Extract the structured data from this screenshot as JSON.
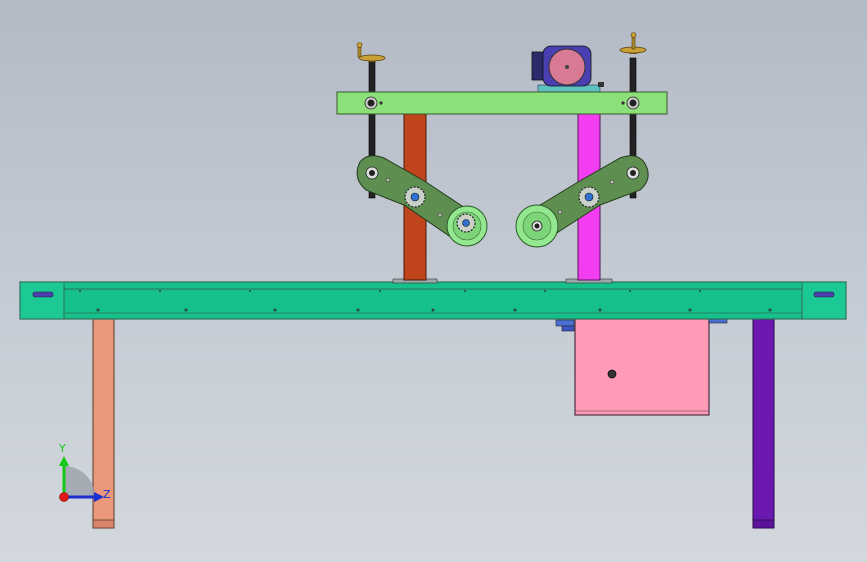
{
  "window": {
    "background_top": "#b3bac6",
    "background_bottom": "#d3d8de"
  },
  "colors": {
    "table_top": "#16c08a",
    "table_edge": "#2f6f55",
    "crossbar": "#8be07a",
    "left_post": "#c0441c",
    "right_post": "#f23ef0",
    "arm": "#5e8f50",
    "roller": "#93e88f",
    "left_leg": "#ea987b",
    "right_leg": "#6a18b0",
    "box": "#ff9bb6",
    "motor_body": "#4a3fb0",
    "motor_face": "#d87a95",
    "handwheel": "#c8a035"
  },
  "icons": {
    "handwheel_left": "handwheel-icon",
    "handwheel_right": "handwheel-icon",
    "motor": "gear-motor-icon"
  },
  "triad": {
    "y_label": "Y",
    "z_label": "Z",
    "y_color": "#14c814",
    "z_color": "#1a2fd0",
    "x_color": "#e01818"
  }
}
